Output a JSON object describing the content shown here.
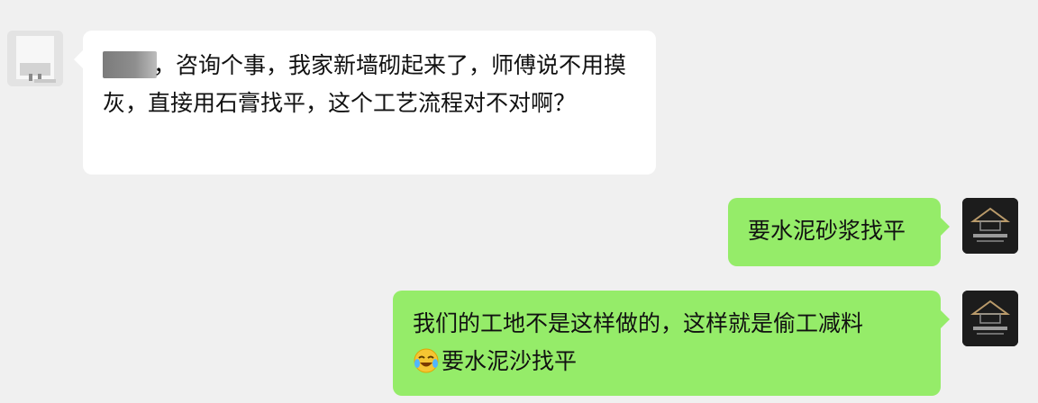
{
  "messages": [
    {
      "direction": "incoming",
      "text": "，咨询个事，我家新墙砌起来了，师傅说不用摸灰，直接用石膏找平，这个工艺流程对不对啊？",
      "sender_name_redacted": true,
      "bubble_color": "#ffffff"
    },
    {
      "direction": "outgoing",
      "text": "要水泥砂浆找平",
      "bubble_color": "#95ec69"
    },
    {
      "direction": "outgoing",
      "text": "我们的工地不是这样做的，这样就是偷工减料",
      "emoji": "crying-laughing-emoji",
      "text_after_emoji": "要水泥沙找平",
      "bubble_color": "#95ec69"
    }
  ],
  "icons": {
    "incoming_avatar": "avatar",
    "outgoing_avatar": "company-logo-avatar"
  },
  "colors": {
    "background": "#f0f0f0",
    "outgoing_bubble": "#95ec69",
    "incoming_bubble": "#ffffff"
  }
}
